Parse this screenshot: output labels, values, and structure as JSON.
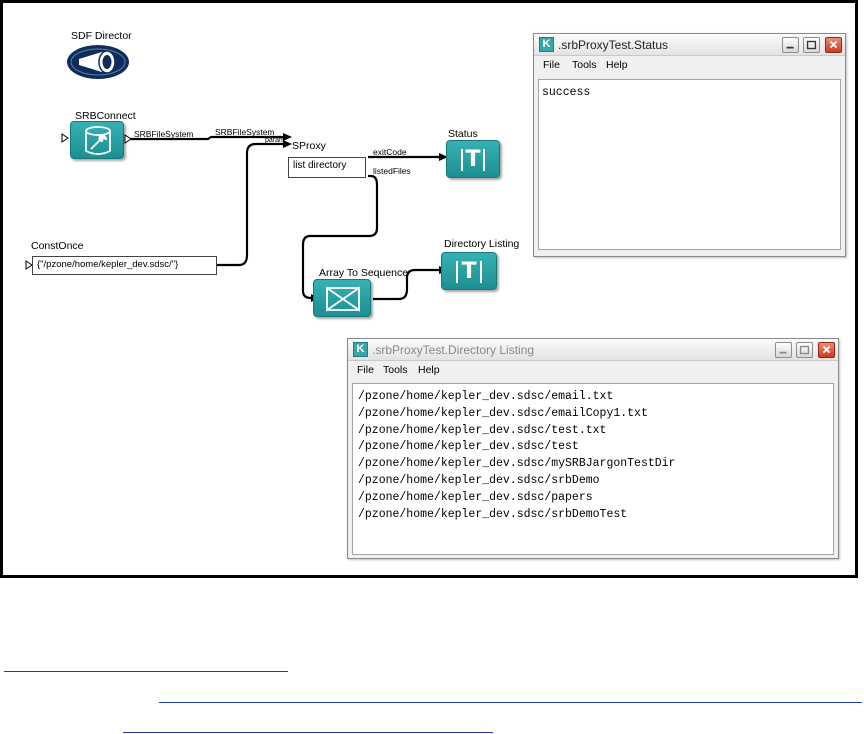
{
  "workflow": {
    "director_label": "SDF Director",
    "srbconnect": {
      "label": "SRBConnect",
      "output_port": "SRBFileSystem"
    },
    "sproxy": {
      "label": "SProxy",
      "param_text": "list directory",
      "input_port_label": "SRBFileSystem",
      "input_port_extra": "param",
      "output_exitcode": "exitCode",
      "output_listedfiles": "listedFiles"
    },
    "constonce": {
      "label": "ConstOnce",
      "value": "{\"/pzone/home/kepler_dev.sdsc/\"}"
    },
    "status_actor": {
      "label": "Status",
      "glyph": "T"
    },
    "array_to_sequence": {
      "label": "Array To Sequence"
    },
    "directory_listing_actor": {
      "label": "Directory Listing",
      "glyph": "T"
    },
    "colors": {
      "actor_teal": "#2aa0a3",
      "wire": "#000000"
    }
  },
  "status_window": {
    "title": ".srbProxyTest.Status",
    "icon": "K",
    "menu": [
      "File",
      "Tools",
      "Help"
    ],
    "content": "success"
  },
  "listing_window": {
    "title": ".srbProxyTest.Directory Listing",
    "icon": "K",
    "menu": [
      "File",
      "Tools",
      "Help"
    ],
    "lines": [
      "/pzone/home/kepler_dev.sdsc/email.txt",
      "/pzone/home/kepler_dev.sdsc/emailCopy1.txt",
      "/pzone/home/kepler_dev.sdsc/test.txt",
      "/pzone/home/kepler_dev.sdsc/test",
      "/pzone/home/kepler_dev.sdsc/mySRBJargonTestDir",
      "/pzone/home/kepler_dev.sdsc/srbDemo",
      "/pzone/home/kepler_dev.sdsc/papers",
      "/pzone/home/kepler_dev.sdsc/srbDemoTest"
    ]
  }
}
